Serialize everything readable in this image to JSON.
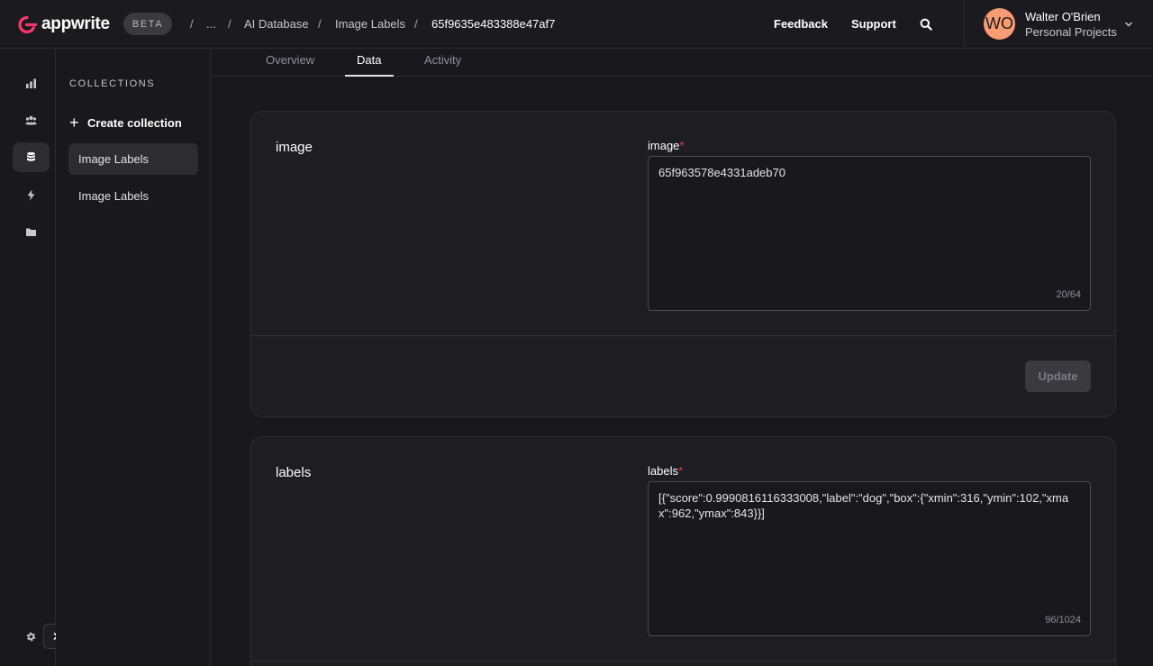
{
  "brand": {
    "name": "appwrite",
    "badge": "BETA",
    "accent": "#fd366e"
  },
  "breadcrumb": {
    "sep": "/",
    "items": [
      "...",
      "AI Database",
      "Image Labels",
      "65f9635e483388e47af7"
    ]
  },
  "header": {
    "feedback": "Feedback",
    "support": "Support",
    "user": {
      "initials": "WO",
      "name": "Walter O'Brien",
      "org": "Personal Projects",
      "avatar_color": "#fb9b71"
    }
  },
  "rail": {
    "icons": [
      "chart-icon",
      "users-icon",
      "database-icon",
      "bolt-icon",
      "folder-icon"
    ],
    "active": "database-icon",
    "bottom": [
      "settings-icon",
      "expand-chevron-icon"
    ]
  },
  "sidebar": {
    "title": "COLLECTIONS",
    "create_label": "Create collection",
    "items": [
      {
        "label": "Image Labels",
        "active": true
      },
      {
        "label": "Image Labels",
        "active": false
      }
    ]
  },
  "tabs": {
    "items": [
      "Overview",
      "Data",
      "Activity"
    ],
    "active": "Data"
  },
  "attributes": [
    {
      "title": "image",
      "label": "image",
      "required": "*",
      "value": "65f963578e4331adeb70",
      "counter": "20/64",
      "button": "Update"
    },
    {
      "title": "labels",
      "label": "labels",
      "required": "*",
      "value": "[{\"score\":0.9990816116333008,\"label\":\"dog\",\"box\":{\"xmin\":316,\"ymin\":102,\"xmax\":962,\"ymax\":843}}]",
      "counter": "96/1024"
    }
  ]
}
